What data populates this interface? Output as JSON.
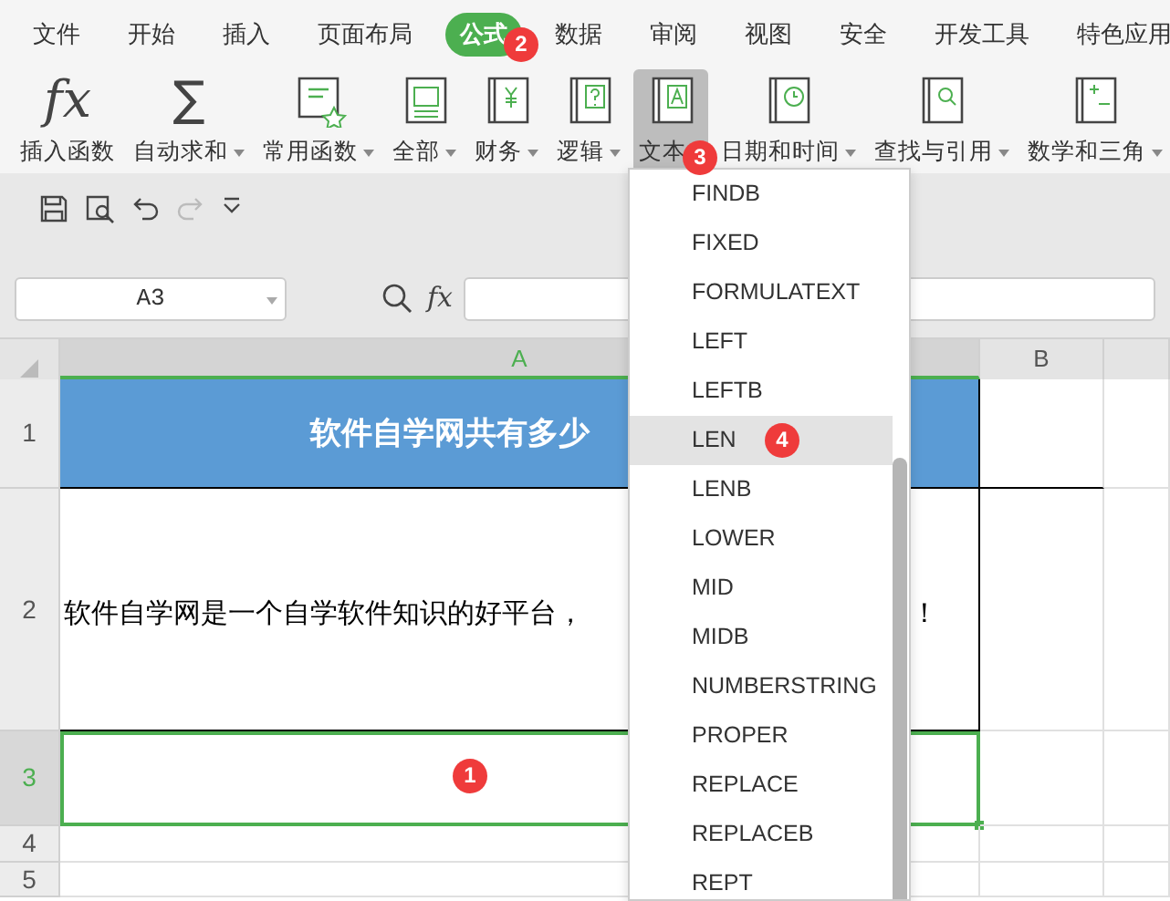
{
  "menu_bar": {
    "items": [
      {
        "label": "文件",
        "selected": false
      },
      {
        "label": "开始",
        "selected": false
      },
      {
        "label": "插入",
        "selected": false
      },
      {
        "label": "页面布局",
        "selected": false
      },
      {
        "label": "公式",
        "selected": true
      },
      {
        "label": "数据",
        "selected": false
      },
      {
        "label": "审阅",
        "selected": false
      },
      {
        "label": "视图",
        "selected": false
      },
      {
        "label": "安全",
        "selected": false
      },
      {
        "label": "开发工具",
        "selected": false
      },
      {
        "label": "特色应用",
        "selected": false
      }
    ]
  },
  "ribbon": {
    "items": [
      {
        "label": "插入函数",
        "kind": "glyph",
        "icon": "fx",
        "dropdown": false,
        "selected": false
      },
      {
        "label": "自动求和",
        "kind": "glyph",
        "icon": "∑",
        "dropdown": true,
        "selected": false
      },
      {
        "label": "常用函数",
        "kind": "star",
        "dropdown": true,
        "selected": false
      },
      {
        "label": "全部",
        "kind": "sheet",
        "dropdown": true,
        "selected": false
      },
      {
        "label": "财务",
        "kind": "book-lines",
        "dropdown": true,
        "selected": false
      },
      {
        "label": "逻辑",
        "kind": "book-q",
        "dropdown": true,
        "selected": false
      },
      {
        "label": "文本",
        "kind": "book-a",
        "dropdown": true,
        "selected": true
      },
      {
        "label": "日期和时间",
        "kind": "book-clock",
        "dropdown": true,
        "selected": false
      },
      {
        "label": "查找与引用",
        "kind": "book-search",
        "dropdown": true,
        "selected": false
      },
      {
        "label": "数学和三角",
        "kind": "book-math",
        "dropdown": true,
        "selected": false
      }
    ]
  },
  "name_box": {
    "value": "A3"
  },
  "formula_bar": {
    "label": "fx"
  },
  "columns": [
    {
      "label": "A",
      "selected": true
    },
    {
      "label": "B",
      "selected": false
    }
  ],
  "rows": [
    {
      "header": "1",
      "selected": false,
      "kind": "title",
      "texts": [
        "软件自学网共有多少"
      ]
    },
    {
      "header": "2",
      "selected": false,
      "kind": "body",
      "texts": [
        "软件自学网是一个自学软件知识的好平台，",
        "！"
      ]
    },
    {
      "header": "3",
      "selected": true,
      "kind": "empty"
    },
    {
      "header": "4",
      "selected": false,
      "kind": "empty"
    },
    {
      "header": "5",
      "selected": false,
      "kind": "empty"
    }
  ],
  "function_menu": {
    "items": [
      {
        "label": "FINDB",
        "selected": false
      },
      {
        "label": "FIXED",
        "selected": false
      },
      {
        "label": "FORMULATEXT",
        "selected": false
      },
      {
        "label": "LEFT",
        "selected": false
      },
      {
        "label": "LEFTB",
        "selected": false
      },
      {
        "label": "LEN",
        "selected": true
      },
      {
        "label": "LENB",
        "selected": false
      },
      {
        "label": "LOWER",
        "selected": false
      },
      {
        "label": "MID",
        "selected": false
      },
      {
        "label": "MIDB",
        "selected": false
      },
      {
        "label": "NUMBERSTRING",
        "selected": false
      },
      {
        "label": "PROPER",
        "selected": false
      },
      {
        "label": "REPLACE",
        "selected": false
      },
      {
        "label": "REPLACEB",
        "selected": false
      },
      {
        "label": "REPT",
        "selected": false
      }
    ]
  },
  "callouts": [
    {
      "text": "1"
    },
    {
      "text": "2"
    },
    {
      "text": "3"
    },
    {
      "text": "4"
    }
  ]
}
